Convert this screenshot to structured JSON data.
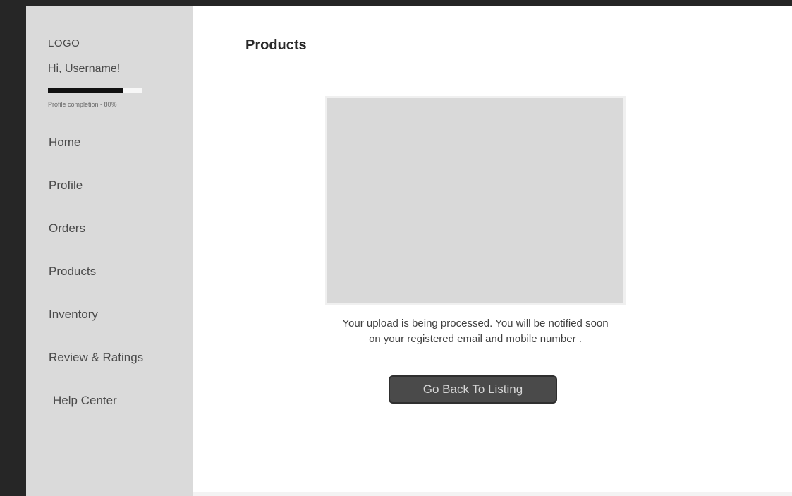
{
  "sidebar": {
    "logo": "LOGO",
    "greeting": "Hi, Username!",
    "profile_completion": {
      "fraction": 0.8,
      "caption": "Profile completion - 80%"
    },
    "items": [
      {
        "label": "Home"
      },
      {
        "label": "Profile"
      },
      {
        "label": "Orders"
      },
      {
        "label": "Products"
      },
      {
        "label": "Inventory"
      },
      {
        "label": "Review & Ratings"
      },
      {
        "label": "Help Center"
      }
    ]
  },
  "main": {
    "title": "Products",
    "message": "Your upload is being processed. You will be notified soon on your registered  email and mobile number .",
    "back_button_label": "Go Back To Listing"
  },
  "colors": {
    "sidebar_bg": "#dadada",
    "main_bg": "#ffffff",
    "frame_bg": "#262626",
    "button_bg": "#4a4a4a",
    "placeholder_bg": "#d9d9d9"
  }
}
